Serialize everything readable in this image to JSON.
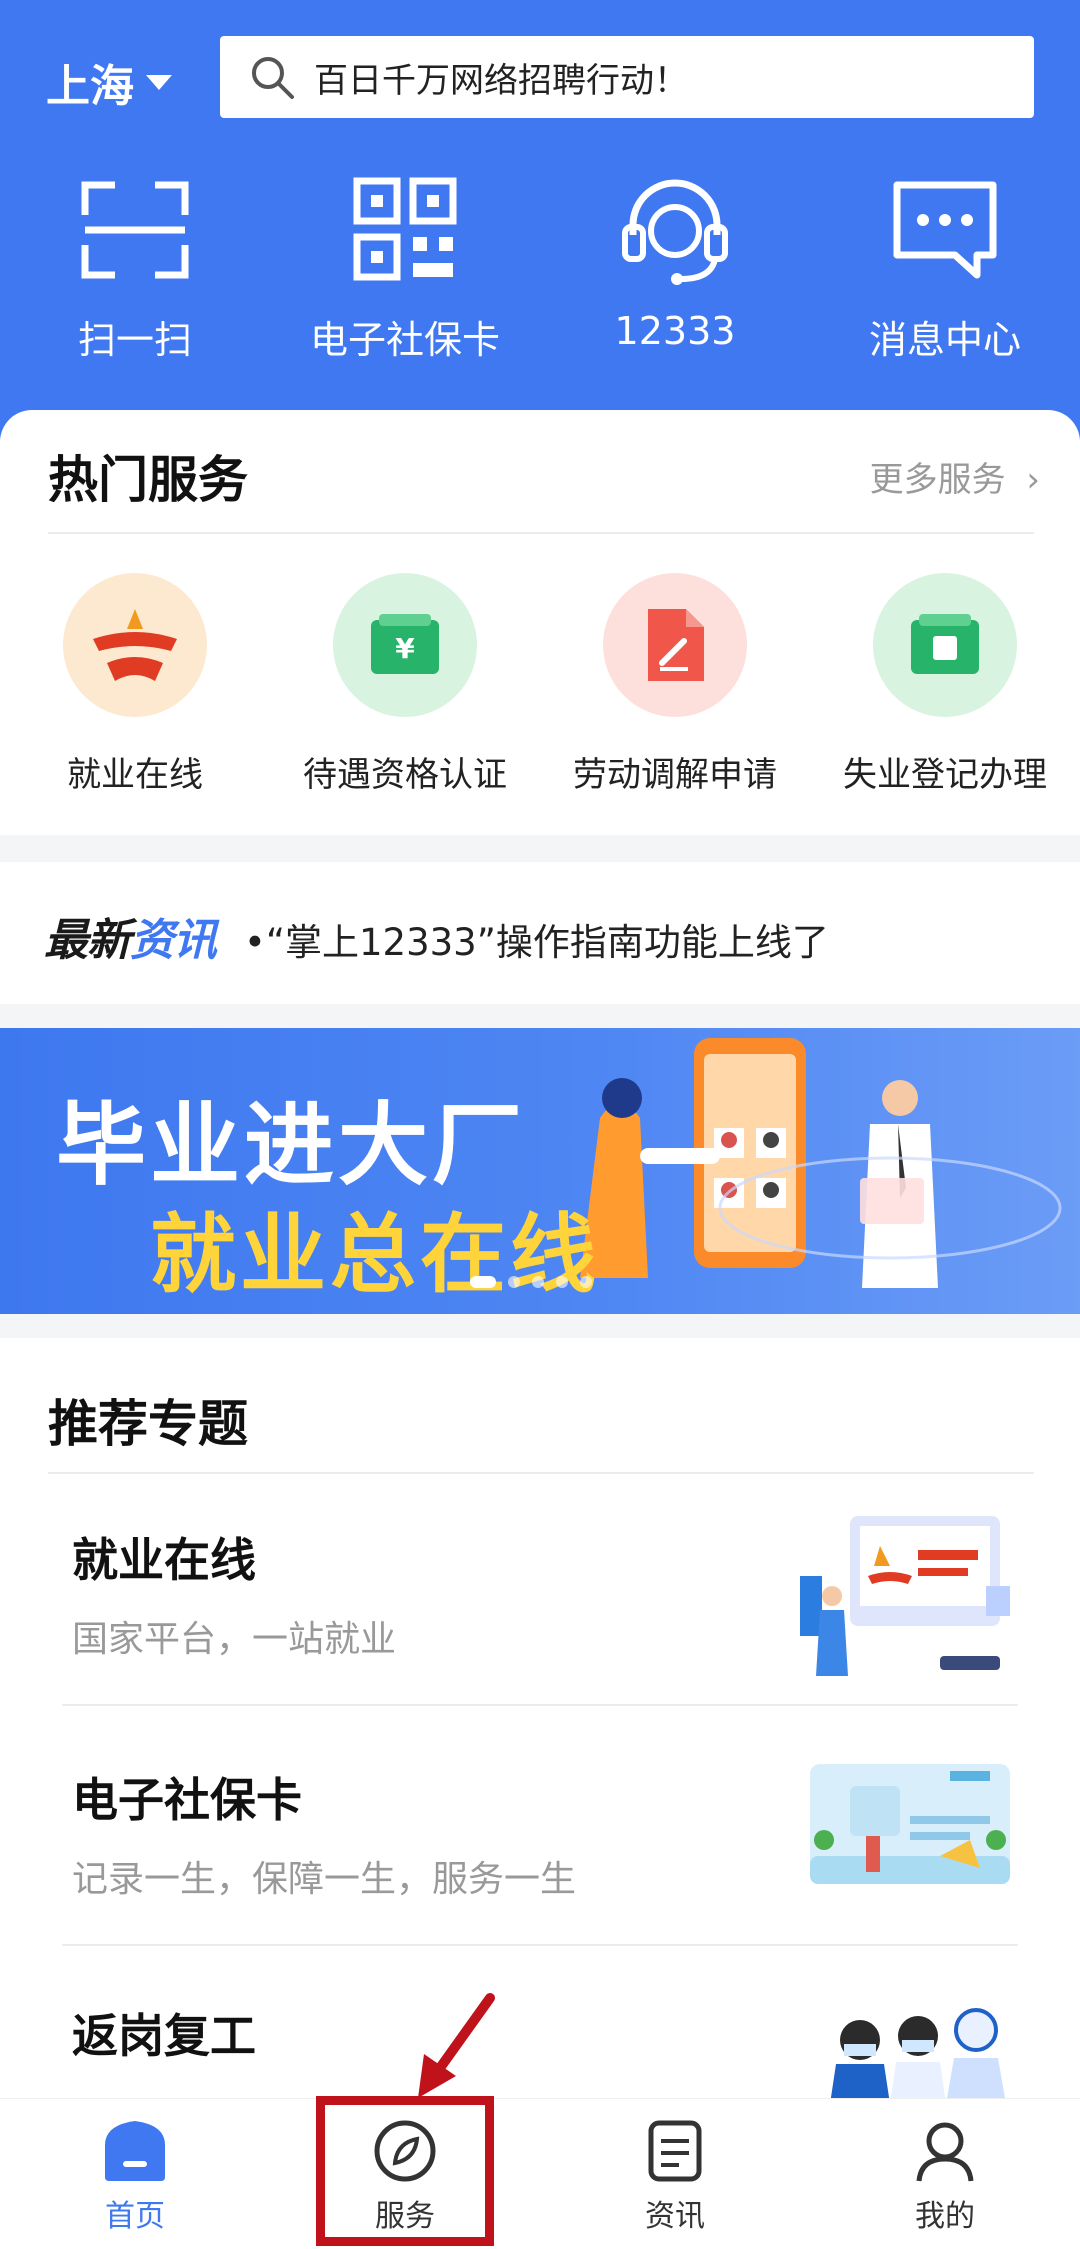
{
  "header": {
    "city": "上海",
    "search_text": "百日千万网络招聘行动！",
    "quick_actions": [
      {
        "label": "扫一扫",
        "icon": "scan-icon"
      },
      {
        "label": "电子社保卡",
        "icon": "qr-code-icon"
      },
      {
        "label": "12333",
        "icon": "headset-icon"
      },
      {
        "label": "消息中心",
        "icon": "message-icon"
      }
    ]
  },
  "hot_services": {
    "title": "热门服务",
    "more": "更多服务",
    "items": [
      {
        "label": "就业在线",
        "icon": "employment-logo-icon"
      },
      {
        "label": "待遇资格认证",
        "icon": "wallet-icon"
      },
      {
        "label": "劳动调解申请",
        "icon": "document-edit-icon"
      },
      {
        "label": "失业登记办理",
        "icon": "wallet-icon"
      }
    ]
  },
  "news": {
    "logo_part1": "最新",
    "logo_part2": "资讯",
    "headline": "•“掌上12333”操作指南功能上线了"
  },
  "banner": {
    "line1": "毕业进大厂",
    "line2": "就业总在线"
  },
  "topics": {
    "title": "推荐专题",
    "items": [
      {
        "title": "就业在线",
        "subtitle": "国家平台，一站就业"
      },
      {
        "title": "电子社保卡",
        "subtitle": "记录一生，保障一生，服务一生"
      },
      {
        "title": "返岗复工",
        "subtitle": ""
      }
    ]
  },
  "tabbar": {
    "items": [
      {
        "label": "首页",
        "icon": "home-icon"
      },
      {
        "label": "服务",
        "icon": "compass-icon"
      },
      {
        "label": "资讯",
        "icon": "news-icon"
      },
      {
        "label": "我的",
        "icon": "profile-icon"
      }
    ]
  },
  "colors": {
    "brand_blue": "#3f78f0",
    "highlight_red": "#c0121b",
    "banner_yellow": "#ffd33a"
  }
}
